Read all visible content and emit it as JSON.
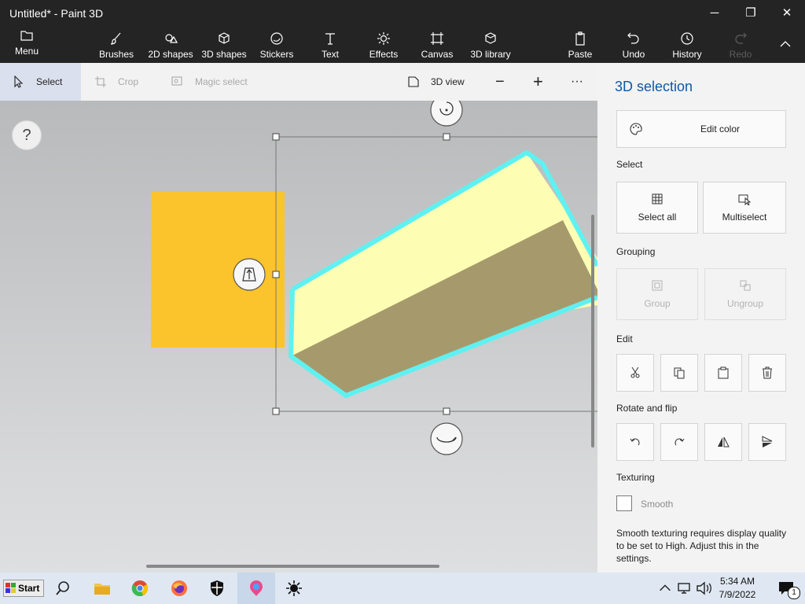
{
  "window": {
    "title": "Untitled* - Paint 3D",
    "controls": {
      "minimize": "─",
      "maximize": "❐",
      "close": "✕"
    }
  },
  "ribbon": {
    "menu": "Menu",
    "brushes": "Brushes",
    "shapes2d": "2D shapes",
    "shapes3d": "3D shapes",
    "stickers": "Stickers",
    "text": "Text",
    "effects": "Effects",
    "canvas": "Canvas",
    "library3d": "3D library",
    "paste": "Paste",
    "undo": "Undo",
    "history": "History",
    "redo": "Redo"
  },
  "toolbar": {
    "select": "Select",
    "crop": "Crop",
    "magic_select": "Magic select",
    "view3d": "3D view",
    "zoom_out": "−",
    "zoom_in": "+",
    "more": "···"
  },
  "canvas": {
    "help": "?"
  },
  "panel": {
    "title": "3D selection",
    "edit_color": "Edit color",
    "select_heading": "Select",
    "select_all": "Select all",
    "multiselect": "Multiselect",
    "grouping_heading": "Grouping",
    "group": "Group",
    "ungroup": "Ungroup",
    "edit_heading": "Edit",
    "rotate_heading": "Rotate and flip",
    "texturing_heading": "Texturing",
    "smooth_label": "Smooth",
    "smooth_note": "Smooth texturing requires display quality to be set to High. Adjust this in the settings."
  },
  "taskbar": {
    "start": "Start",
    "time": "5:34 AM",
    "date": "7/9/2022",
    "notification_count": "1",
    "icons": [
      "search-icon",
      "file-explorer-icon",
      "chrome-icon",
      "firefox-icon",
      "security-icon",
      "paint3d-icon",
      "brightness-icon"
    ]
  },
  "colors": {
    "accent": "#0b5aa8",
    "orange_square": "#fcc42c",
    "box_top": "#fdfdb3",
    "box_side": "#a69a6c",
    "selection_glow": "#5ff1f2"
  }
}
